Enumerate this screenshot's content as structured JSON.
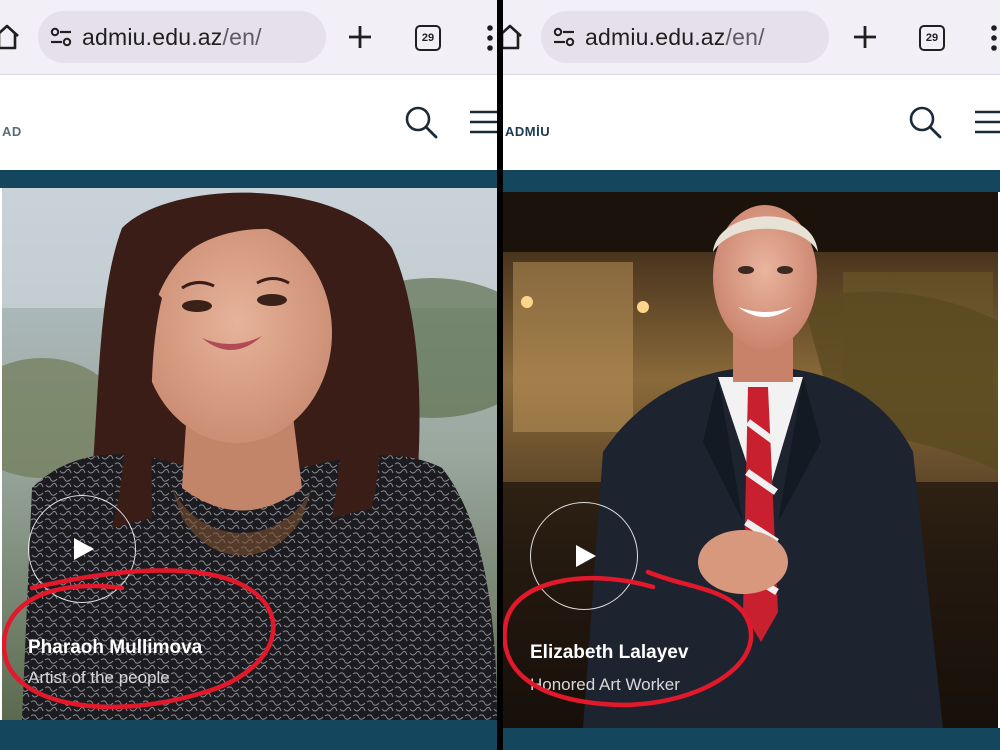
{
  "browser": {
    "url_domain": "admiu.edu.az",
    "url_path": "/en/",
    "tab_count": "29"
  },
  "left": {
    "logo_text": "AD",
    "person": {
      "name": "Pharaoh Mullimova",
      "title": "Artist of the people"
    }
  },
  "right": {
    "logo_text": "ADMİU",
    "person": {
      "name": "Elizabeth Lalayev",
      "title": "Honored Art Worker"
    }
  },
  "colors": {
    "header_strip": "#14465e",
    "annotation": "#e3192b",
    "chrome_bg": "#f3eff6"
  }
}
